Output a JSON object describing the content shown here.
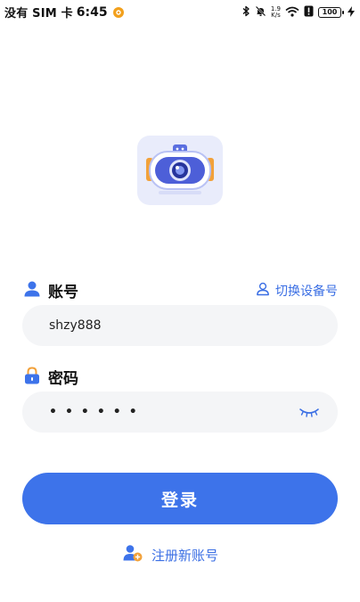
{
  "status_bar": {
    "carrier": "没有 SIM 卡",
    "time": "6:45",
    "net_speed_value": "1.9",
    "net_speed_unit": "K/s",
    "battery": "100"
  },
  "login": {
    "account_label": "账号",
    "switch_device_label": "切换设备号",
    "account_value": "shzy888",
    "password_label": "密码",
    "password_mask": "••••••",
    "login_button_label": "登录",
    "register_label": "注册新账号"
  },
  "colors": {
    "primary": "#3d73ea",
    "link": "#3b6fe4",
    "input_bg": "#f4f5f7",
    "logo_bg": "#e9ecfb"
  },
  "icons": {
    "notification": "orange-circle-icon",
    "bluetooth": "bluetooth-icon",
    "mute": "bell-off-icon",
    "wifi": "wifi-icon",
    "alert": "alert-badge-icon",
    "charging": "bolt-icon",
    "account": "user-icon",
    "switch_device": "user-outline-icon",
    "password": "lock-icon",
    "eye": "eye-closed-icon",
    "register": "add-user-icon"
  }
}
